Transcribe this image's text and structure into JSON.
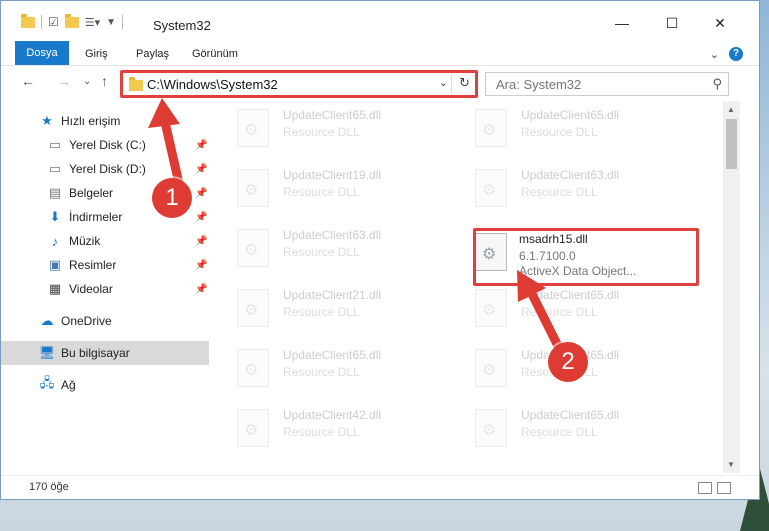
{
  "window": {
    "title": "System32",
    "controls": {
      "minimize": "—",
      "maximize": "☐",
      "close": "✕"
    }
  },
  "ribbon": {
    "tabs": [
      "Dosya",
      "Giriş",
      "Paylaş",
      "Görünüm"
    ]
  },
  "navigation": {
    "address": "C:\\Windows\\System32",
    "search_placeholder": "Ara: System32"
  },
  "sidebar": {
    "items": [
      {
        "label": "Hızlı erişim",
        "icon": "star-icon"
      },
      {
        "label": "Yerel Disk (C:)",
        "icon": "drive-icon",
        "pinned": true
      },
      {
        "label": "Yerel Disk (D:)",
        "icon": "drive-icon",
        "pinned": true
      },
      {
        "label": "Belgeler",
        "icon": "documents-icon",
        "pinned": true
      },
      {
        "label": "İndirmeler",
        "icon": "download-icon",
        "pinned": true
      },
      {
        "label": "Müzik",
        "icon": "music-icon",
        "pinned": true
      },
      {
        "label": "Resimler",
        "icon": "pictures-icon",
        "pinned": true
      },
      {
        "label": "Videolar",
        "icon": "video-icon",
        "pinned": true
      },
      {
        "label": "OneDrive",
        "icon": "cloud-icon"
      },
      {
        "label": "Bu bilgisayar",
        "icon": "computer-icon",
        "selected": true
      },
      {
        "label": "Ağ",
        "icon": "network-icon"
      }
    ]
  },
  "files": {
    "left_column": [
      {
        "name": "UpdateClient65.dll",
        "desc": "Resource DLL"
      },
      {
        "name": "UpdateClient19.dll",
        "desc": "Resource DLL"
      },
      {
        "name": "UpdateClient63.dll",
        "desc": "Resource DLL"
      },
      {
        "name": "UpdateClient21.dll",
        "desc": "Resource DLL"
      },
      {
        "name": "UpdateClient65.dll",
        "desc": "Resource DLL"
      },
      {
        "name": "UpdateClient42.dll",
        "desc": "Resource DLL"
      }
    ],
    "right_column": [
      {
        "name": "UpdateClient65.dll",
        "desc": "Resource DLL"
      },
      {
        "name": "UpdateClient63.dll",
        "desc": "Resource DLL"
      },
      {
        "name": "msadrh15.dll",
        "desc": "6.1.7100.0",
        "desc2": "ActiveX Data Object...",
        "highlight": true
      },
      {
        "name": "UpdateClient65.dll",
        "desc": "Resource DLL"
      },
      {
        "name": "UpdateClient65.dll",
        "desc": "Resource DLL"
      },
      {
        "name": "UpdateClient65.dll",
        "desc": "Resource DLL"
      }
    ]
  },
  "status": {
    "item_count": "170 öğe"
  },
  "annotations": {
    "badge1": "1",
    "badge2": "2",
    "color": "#dd3b33"
  }
}
